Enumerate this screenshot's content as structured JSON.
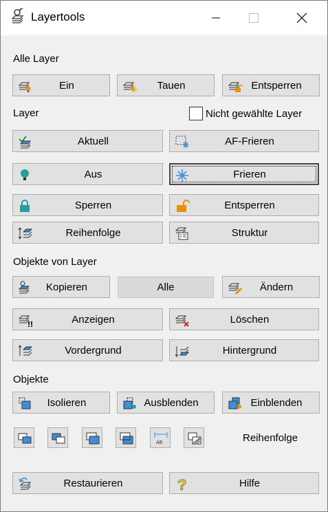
{
  "window": {
    "title": "Layertools"
  },
  "sections": {
    "alle_layer": "Alle Layer",
    "layer": "Layer",
    "nicht_gewaehlte": "Nicht gewählte Layer",
    "objekte_von_layer": "Objekte von Layer",
    "objekte": "Objekte"
  },
  "buttons": {
    "ein": "Ein",
    "tauen": "Tauen",
    "entsperren_all": "Entsperren",
    "aktuell": "Aktuell",
    "af_frieren": "AF-Frieren",
    "aus": "Aus",
    "frieren": "Frieren",
    "sperren": "Sperren",
    "entsperren": "Entsperren",
    "reihenfolge": "Reihenfolge",
    "struktur": "Struktur",
    "kopieren": "Kopieren",
    "alle": "Alle",
    "aendern": "Ändern",
    "anzeigen": "Anzeigen",
    "loeschen": "Löschen",
    "vordergrund": "Vordergrund",
    "hintergrund": "Hintergrund",
    "isolieren": "Isolieren",
    "ausblenden": "Ausblenden",
    "einblenden": "Einblenden",
    "restaurieren": "Restaurieren",
    "hilfe": "Hilfe"
  },
  "reihenfolge_label": "Reihenfolge",
  "checkbox": {
    "nicht_gewaehlte_checked": false
  },
  "icons": [
    "layers-icon",
    "bulb-icon",
    "sun-icon",
    "unlock-icon",
    "checkmark-icon",
    "snowflake-icon",
    "lock-icon",
    "arrows-icon",
    "structure-icon",
    "copy-icon",
    "edit-icon",
    "exclamation-icon",
    "delete-x-icon",
    "help-icon",
    "bring-front-icon",
    "send-back-icon"
  ],
  "colors": {
    "accent_blue": "#3d8fd6",
    "bulb_teal": "#2a9d9d",
    "orange": "#e8920c",
    "red": "#d4202a",
    "yellow": "#f2d300"
  }
}
